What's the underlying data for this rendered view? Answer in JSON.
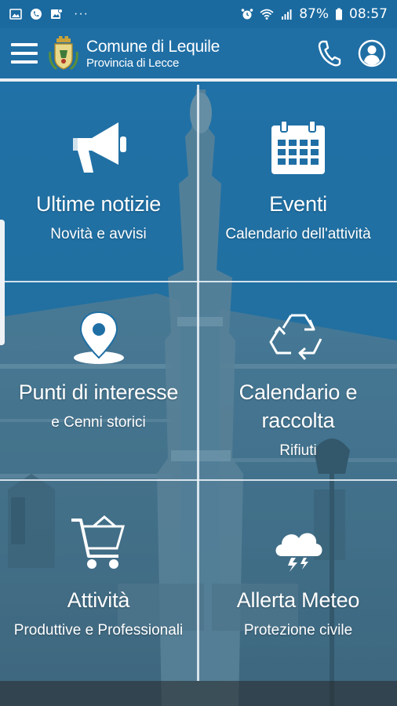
{
  "status_bar": {
    "battery": "87%",
    "time": "08:57",
    "dots": "···"
  },
  "header": {
    "title": "Comune di Lequile",
    "subtitle": "Provincia di Lecce"
  },
  "tiles": [
    {
      "title": "Ultime notizie",
      "subtitle": "Novità e avvisi",
      "icon": "megaphone-icon"
    },
    {
      "title": "Eventi",
      "subtitle": "Calendario dell'attività",
      "icon": "calendar-icon"
    },
    {
      "title": "Punti di interesse",
      "subtitle": "e Cenni storici",
      "icon": "map-pin-icon"
    },
    {
      "title": "Calendario e raccolta",
      "subtitle": "Rifiuti",
      "icon": "recycle-icon"
    },
    {
      "title": "Attività",
      "subtitle": "Produttive e Professionali",
      "icon": "shopping-cart-icon"
    },
    {
      "title": "Allerta Meteo",
      "subtitle": "Protezione civile",
      "icon": "storm-cloud-icon"
    }
  ],
  "colors": {
    "app_bar": "#1f6fa5",
    "status_bar": "#1a6aa0",
    "tile_overlay": "#1f6fa5"
  }
}
